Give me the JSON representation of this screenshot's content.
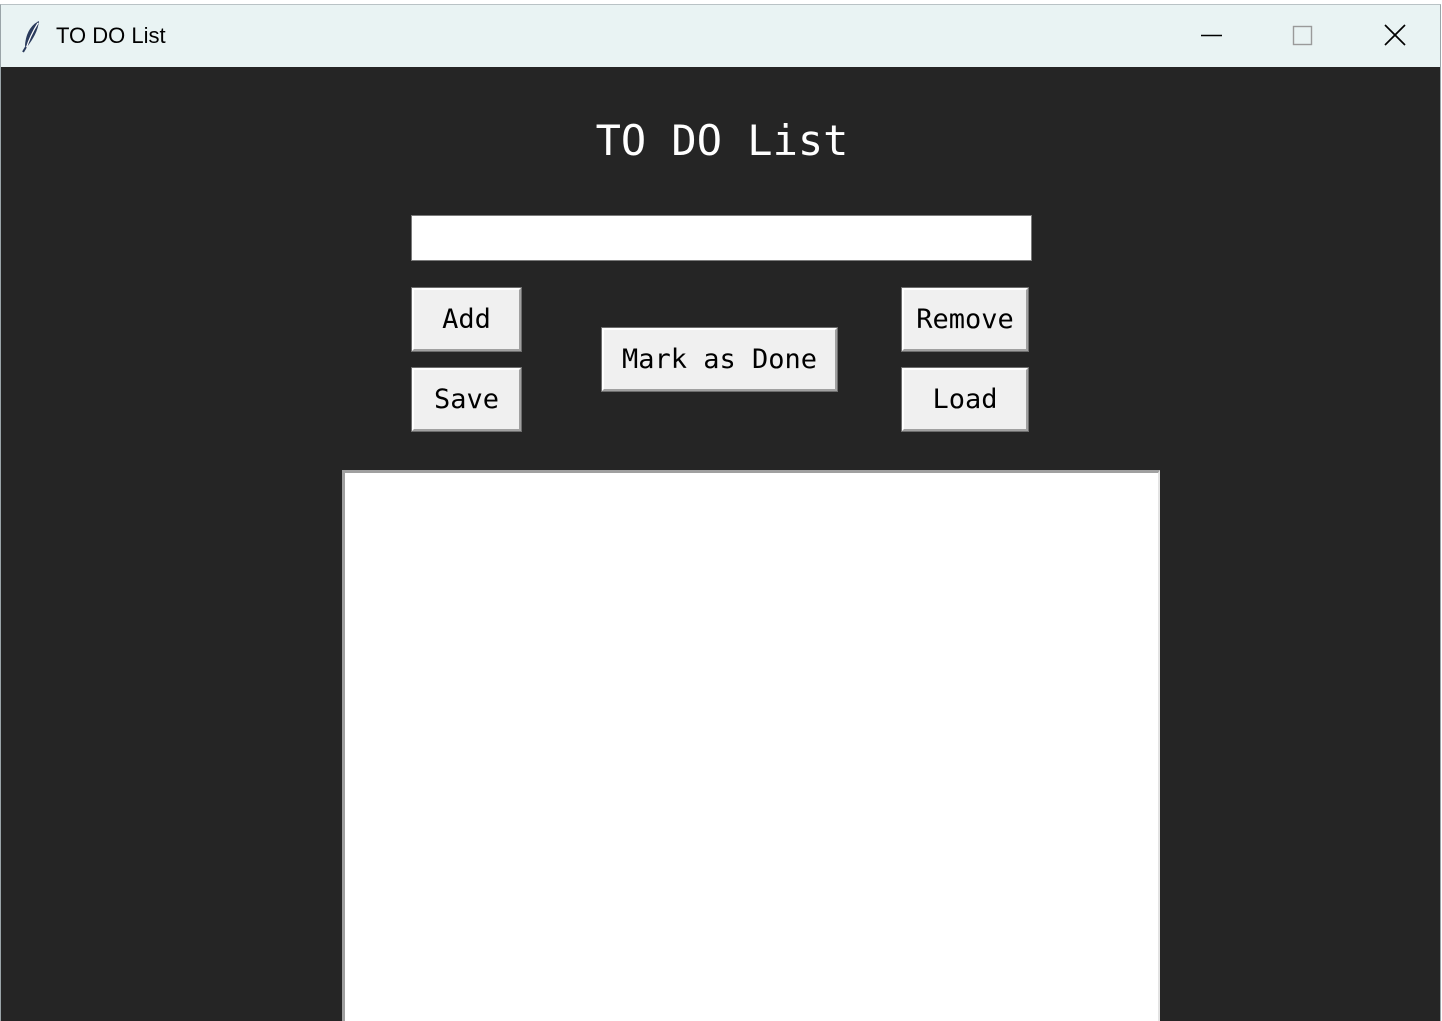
{
  "window": {
    "title": "TO DO List",
    "app_icon": "feather-icon",
    "controls": {
      "minimize_icon": "minimize-icon",
      "maximize_icon": "maximize-icon",
      "close_icon": "close-icon"
    }
  },
  "app": {
    "heading": "TO DO List",
    "task_input": {
      "value": "",
      "placeholder": ""
    },
    "buttons": {
      "add": "Add",
      "save": "Save",
      "mark_done": "Mark as Done",
      "remove": "Remove",
      "load": "Load"
    },
    "tasks": []
  },
  "colors": {
    "background": "#252525",
    "titlebar": "#e9f3f3",
    "button_face": "#f0f0f0",
    "text_light": "#ffffff"
  }
}
